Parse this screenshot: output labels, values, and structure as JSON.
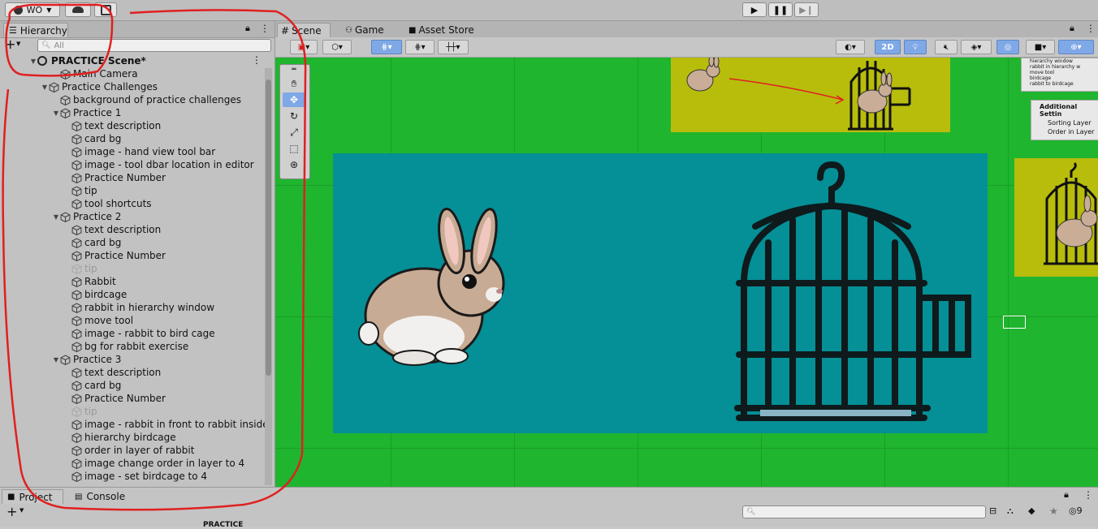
{
  "toolbar": {
    "account_label": "WO",
    "account_icon": "account-icon",
    "cloud_icon": "cloud-icon",
    "collab_icon": "collab-icon",
    "play_icon": "play-icon",
    "pause_icon": "pause-icon",
    "step_icon": "step-icon"
  },
  "hierarchy": {
    "tab_label": "Hierarchy",
    "search_placeholder": "All",
    "add_label": "+",
    "scene_name": "PRACTICE Scene*",
    "items": [
      {
        "label": "Main Camera",
        "depth": 2,
        "arrow": false,
        "dim": false
      },
      {
        "label": "Practice Challenges",
        "depth": 1,
        "arrow": true,
        "dim": false
      },
      {
        "label": "background of practice challenges",
        "depth": 2,
        "arrow": false,
        "dim": false
      },
      {
        "label": "Practice 1",
        "depth": 2,
        "arrow": true,
        "dim": false
      },
      {
        "label": "text description",
        "depth": 3,
        "arrow": false,
        "dim": false
      },
      {
        "label": "card bg",
        "depth": 3,
        "arrow": false,
        "dim": false
      },
      {
        "label": "image - hand view tool bar",
        "depth": 3,
        "arrow": false,
        "dim": false
      },
      {
        "label": "image - tool dbar location in editor",
        "depth": 3,
        "arrow": false,
        "dim": false
      },
      {
        "label": "Practice Number",
        "depth": 3,
        "arrow": false,
        "dim": false
      },
      {
        "label": "tip",
        "depth": 3,
        "arrow": false,
        "dim": false
      },
      {
        "label": "tool shortcuts",
        "depth": 3,
        "arrow": false,
        "dim": false
      },
      {
        "label": "Practice 2",
        "depth": 2,
        "arrow": true,
        "dim": false
      },
      {
        "label": "text description",
        "depth": 3,
        "arrow": false,
        "dim": false
      },
      {
        "label": "card bg",
        "depth": 3,
        "arrow": false,
        "dim": false
      },
      {
        "label": "Practice Number",
        "depth": 3,
        "arrow": false,
        "dim": false
      },
      {
        "label": "tip",
        "depth": 3,
        "arrow": false,
        "dim": true
      },
      {
        "label": "Rabbit",
        "depth": 3,
        "arrow": false,
        "dim": false
      },
      {
        "label": "birdcage",
        "depth": 3,
        "arrow": false,
        "dim": false
      },
      {
        "label": "rabbit in hierarchy window",
        "depth": 3,
        "arrow": false,
        "dim": false
      },
      {
        "label": "move tool",
        "depth": 3,
        "arrow": false,
        "dim": false
      },
      {
        "label": "image - rabbit to bird cage",
        "depth": 3,
        "arrow": false,
        "dim": false
      },
      {
        "label": "bg for rabbit exercise",
        "depth": 3,
        "arrow": false,
        "dim": false
      },
      {
        "label": "Practice 3",
        "depth": 2,
        "arrow": true,
        "dim": false
      },
      {
        "label": "text description",
        "depth": 3,
        "arrow": false,
        "dim": false
      },
      {
        "label": "card bg",
        "depth": 3,
        "arrow": false,
        "dim": false
      },
      {
        "label": "Practice Number",
        "depth": 3,
        "arrow": false,
        "dim": false
      },
      {
        "label": "tip",
        "depth": 3,
        "arrow": false,
        "dim": true
      },
      {
        "label": "image - rabbit in front to rabbit inside",
        "depth": 3,
        "arrow": false,
        "dim": false
      },
      {
        "label": "hierarchy birdcage",
        "depth": 3,
        "arrow": false,
        "dim": false
      },
      {
        "label": "order in layer of rabbit",
        "depth": 3,
        "arrow": false,
        "dim": false
      },
      {
        "label": "image change order in layer to 4",
        "depth": 3,
        "arrow": false,
        "dim": false
      },
      {
        "label": "image - set birdcage to 4",
        "depth": 3,
        "arrow": false,
        "dim": false
      }
    ]
  },
  "scene": {
    "tabs": [
      {
        "label": "Scene",
        "icon": "hash-icon"
      },
      {
        "label": "Game",
        "icon": "gamepad-icon"
      },
      {
        "label": "Asset Store",
        "icon": "bag-icon"
      }
    ],
    "toggle_2d": "2D",
    "gizmo_count": "",
    "preview_lines": [
      "hierarchy window",
      "rabbit in hierarchy w",
      "move tool",
      "birdcage",
      "rabbit to birdcage"
    ],
    "settings_title": "Additional Settin",
    "settings_rows": [
      "Sorting Layer",
      "Order in Layer"
    ],
    "viewport_bg": "#1fb52f",
    "panel_bg": "#058f96",
    "card_bg": "#b8bd0c"
  },
  "bottom": {
    "tabs": [
      {
        "label": "Project",
        "icon": "folder-icon"
      },
      {
        "label": "Console",
        "icon": "console-icon"
      }
    ],
    "add_label": "+",
    "hidden_count": "9",
    "breadcrumb": "PRACTICE"
  },
  "annotation_color": "#e02020"
}
